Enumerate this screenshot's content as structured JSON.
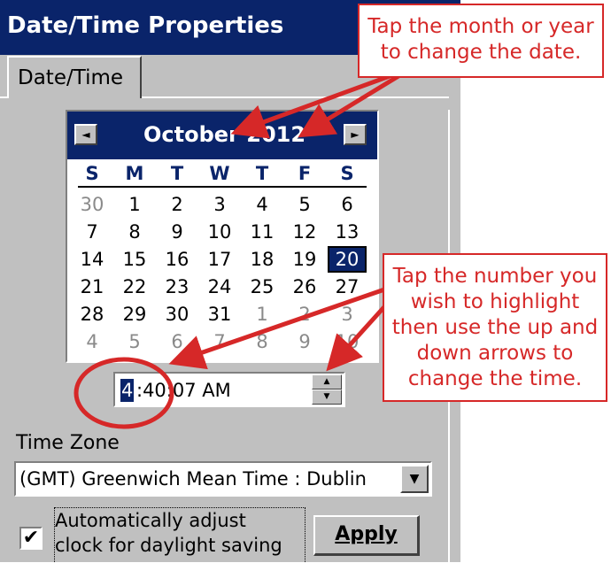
{
  "window": {
    "title": "Date/Time Properties"
  },
  "tabs": [
    {
      "label": "Date/Time"
    }
  ],
  "calendar": {
    "month_year": "October 2012",
    "prev_symbol": "◄",
    "next_symbol": "►",
    "weekdays": [
      "S",
      "M",
      "T",
      "W",
      "T",
      "F",
      "S"
    ],
    "weeks": [
      [
        "30",
        "1",
        "2",
        "3",
        "4",
        "5",
        "6"
      ],
      [
        "7",
        "8",
        "9",
        "10",
        "11",
        "12",
        "13"
      ],
      [
        "14",
        "15",
        "16",
        "17",
        "18",
        "19",
        "20"
      ],
      [
        "21",
        "22",
        "23",
        "24",
        "25",
        "26",
        "27"
      ],
      [
        "28",
        "29",
        "30",
        "31",
        "1",
        "2",
        "3"
      ],
      [
        "4",
        "5",
        "6",
        "7",
        "8",
        "9",
        "10"
      ]
    ],
    "selected_day": "20"
  },
  "time": {
    "hour": "4",
    "rest": ":40:07 AM",
    "spin_up": "▲",
    "spin_down": "▼"
  },
  "timezone": {
    "label": "Time Zone",
    "value": "(GMT) Greenwich Mean Time : Dublin",
    "dropdown_symbol": "▼"
  },
  "dst": {
    "checked": true,
    "check_symbol": "✔",
    "label_line1": "Automatically adjust",
    "label_line2": "clock for daylight saving"
  },
  "apply_label": "Apply",
  "callouts": {
    "date": [
      "Tap the month or year",
      "to change the date."
    ],
    "time": [
      "Tap the number you",
      "wish to highlight",
      "then use the up and",
      "down arrows to",
      "change the time."
    ]
  },
  "colors": {
    "titlebar": "#0a246a",
    "dialog": "#c0c0c0",
    "annotation": "#d62828"
  }
}
